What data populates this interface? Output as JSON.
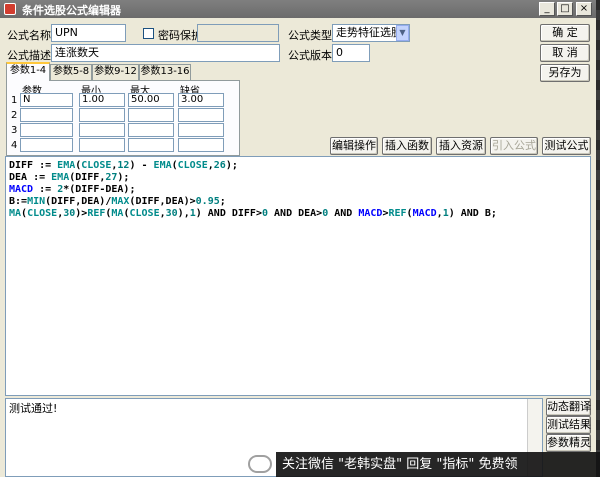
{
  "window": {
    "title": "条件选股公式编辑器",
    "controls": {
      "minimize": "_",
      "maximize": "□",
      "close": "×"
    }
  },
  "form": {
    "name_label": "公式名称",
    "name_value": "UPN",
    "password_label": "密码保护",
    "password_checked": false,
    "desc_label": "公式描述",
    "desc_value": "连涨数天",
    "type_label": "公式类型",
    "type_value": "走势特征选股",
    "version_label": "公式版本",
    "version_value": "0"
  },
  "actions": {
    "ok": "确  定",
    "cancel": "取  消",
    "save_as": "另存为"
  },
  "tabs": [
    "参数1-4",
    "参数5-8",
    "参数9-12",
    "参数13-16"
  ],
  "params": {
    "headers": [
      "参数",
      "最小",
      "最大",
      "缺省"
    ],
    "rows": [
      {
        "no": "1",
        "name": "N",
        "min": "1.00",
        "max": "50.00",
        "default": "3.00"
      },
      {
        "no": "2",
        "name": "",
        "min": "",
        "max": "",
        "default": ""
      },
      {
        "no": "3",
        "name": "",
        "min": "",
        "max": "",
        "default": ""
      },
      {
        "no": "4",
        "name": "",
        "min": "",
        "max": "",
        "default": ""
      }
    ]
  },
  "toolbar": {
    "edit_ops": "编辑操作",
    "insert_func": "插入函数",
    "insert_res": "插入资源",
    "ref_formula": "引入公式",
    "test_formula": "测试公式"
  },
  "code_lines": [
    "DIFF := EMA(CLOSE,12) - EMA(CLOSE,26);",
    "DEA := EMA(DIFF,27);",
    "MACD := 2*(DIFF-DEA);",
    "B:=MIN(DIFF,DEA)/MAX(DIFF,DEA)>0.95;",
    "MA(CLOSE,30)>REF(MA(CLOSE,30),1) AND DIFF>0 AND DEA>0 AND MACD>REF(MACD,1) AND B;"
  ],
  "status": {
    "text": "测试通过!"
  },
  "side_buttons": [
    "动态翻译",
    "测试结果",
    "参数精灵"
  ],
  "watermark": "关注微信 \"老韩实盘\" 回复 \"指标\" 免费领"
}
